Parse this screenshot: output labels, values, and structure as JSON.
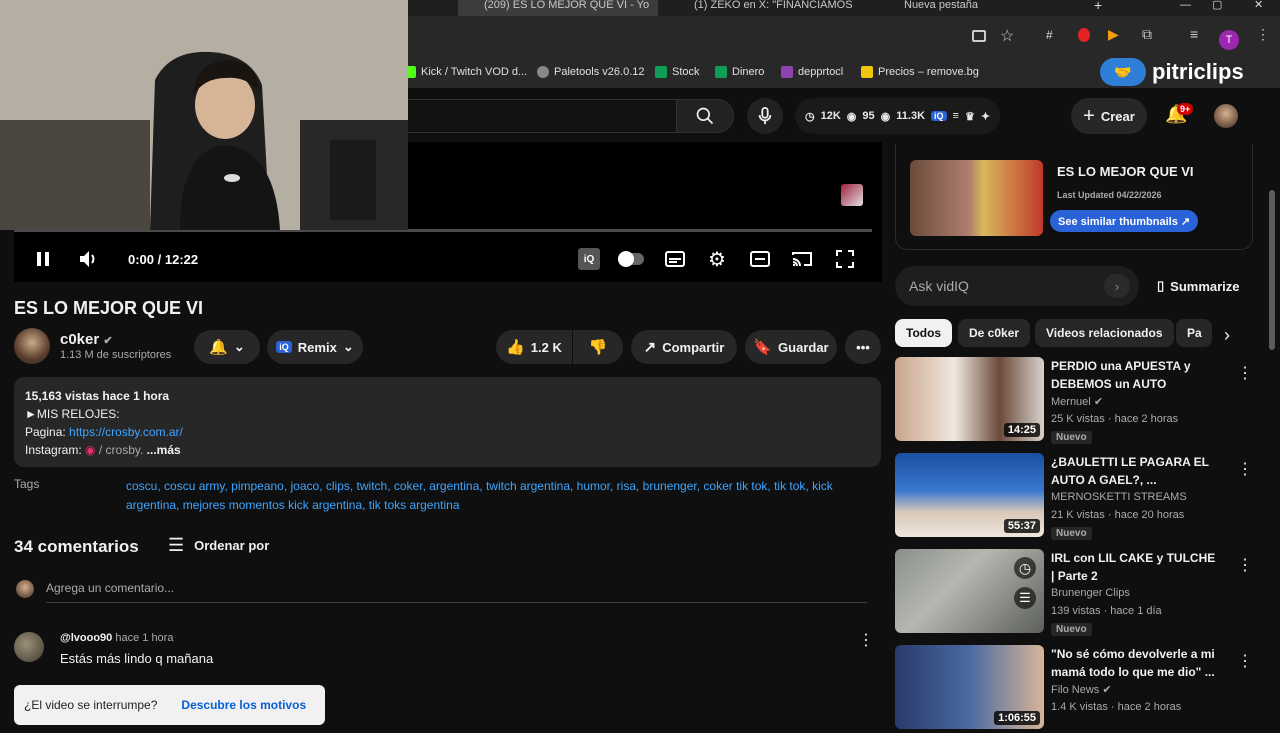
{
  "browser": {
    "tabs": [
      {
        "label": "(209) ES LO MEJOR QUE VI - Yo",
        "active": true
      },
      {
        "label": "(1) ZEKO en X: \"FINANCIAMOS",
        "active": false
      },
      {
        "label": "Nueva pestaña",
        "active": false
      }
    ],
    "bookmarks": [
      "Kick / Twitch VOD d...",
      "Paletools v26.0.12",
      "Stock",
      "Dinero",
      "depprtocl",
      "Precios – remove.bg"
    ],
    "profile_letter": "T",
    "colors": {
      "tab_active": "#3c3c3c",
      "chrome_bg": "#282828",
      "accent": "#3ea6ff"
    }
  },
  "watermark": "pitriclips",
  "header": {
    "stats": {
      "views": "12K",
      "likes": "95",
      "watching": "11.3K"
    },
    "create_label": "Crear",
    "notifications_badge": "9+"
  },
  "player": {
    "time": "0:00 / 12:22",
    "progress": 0.0
  },
  "video": {
    "title": "ES LO MEJOR QUE VI",
    "channel": "c0ker",
    "subscribers": "1.13 M de suscriptores",
    "remix_label": "Remix",
    "likes": "1.2 K",
    "share_label": "Compartir",
    "save_label": "Guardar"
  },
  "description": {
    "meta": "15,163 vistas  hace 1 hora",
    "line1": "►MIS RELOJES:",
    "line2_label": "Pagina: ",
    "line2_link": "https://crosby.com.ar/",
    "line3_label": "Instagram: ",
    "line3_value": " / crosby.",
    "more": "...más"
  },
  "tags": {
    "label": "Tags",
    "text": "coscu, coscu army, pimpeano, joaco, clips, twitch, coker, argentina, twitch argentina, humor, risa, brunenger, coker tik tok, tik tok, kick argentina, mejores momentos kick argentina, tik toks argentina"
  },
  "comments": {
    "count_label": "34 comentarios",
    "sort_label": "Ordenar por",
    "add_placeholder": "Agrega un comentario...",
    "items": [
      {
        "author": "@lvooo90",
        "time": "hace 1 hora",
        "text": "Estás más lindo q mañana"
      }
    ]
  },
  "toast": {
    "question": "¿El video se interrumpe?",
    "link": "Descubre los motivos"
  },
  "sidebar": {
    "vidiq_card": {
      "title": "ES LO MEJOR QUE VI",
      "updated": "Last Updated 04/22/2026",
      "button": "See similar thumbnails ↗"
    },
    "ask_placeholder": "Ask vidIQ",
    "summarize_label": "Summarize",
    "chips": [
      "Todos",
      "De c0ker",
      "Videos relacionados",
      "Pa"
    ],
    "recommendations": [
      {
        "title": "PERDIO una APUESTA y DEBEMOS un AUTO",
        "channel": "Mernuel",
        "meta": "25 K vistas · hace 2 horas",
        "badge": "Nuevo",
        "duration": "14:25"
      },
      {
        "title": "¿BAULETTI LE PAGARA EL AUTO A GAEL?, ...",
        "channel": "MERNOSKETTI STREAMS",
        "meta": "21 K vistas · hace 20 horas",
        "badge": "Nuevo",
        "duration": "55:37"
      },
      {
        "title": "IRL con LIL CAKE y TULCHE | Parte 2",
        "channel": "Brunenger Clips",
        "meta": "139 vistas · hace 1 día",
        "badge": "Nuevo",
        "duration": ""
      },
      {
        "title": "\"No sé cómo devolverle a mi mamá todo lo que me dio\" ...",
        "channel": "Filo News",
        "meta": "1.4 K vistas · hace 2 horas",
        "badge": "",
        "duration": "1:06:55"
      }
    ]
  }
}
